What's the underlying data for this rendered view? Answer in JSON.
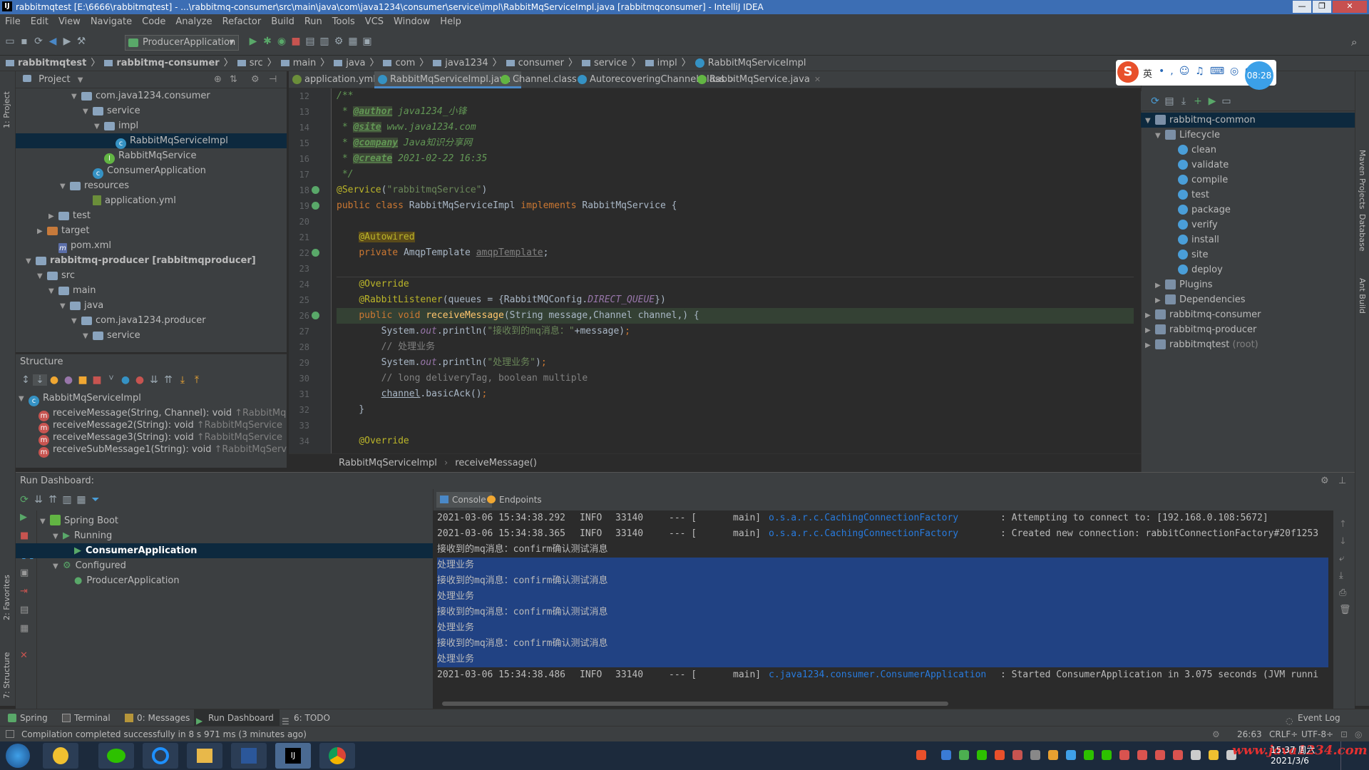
{
  "window": {
    "title": "rabbitmqtest [E:\\6666\\rabbitmqtest] - ...\\rabbitmq-consumer\\src\\main\\java\\com\\java1234\\consumer\\service\\impl\\RabbitMqServiceImpl.java [rabbitmqconsumer] - IntelliJ IDEA",
    "min": "—",
    "max": "❐",
    "close": "✕"
  },
  "menu": [
    "File",
    "Edit",
    "View",
    "Navigate",
    "Code",
    "Analyze",
    "Refactor",
    "Build",
    "Run",
    "Tools",
    "VCS",
    "Window",
    "Help"
  ],
  "toolbar": {
    "run_config": "ProducerApplication"
  },
  "navbar": [
    "rabbitmqtest",
    "rabbitmq-consumer",
    "src",
    "main",
    "java",
    "com",
    "java1234",
    "consumer",
    "service",
    "impl",
    "RabbitMqServiceImpl"
  ],
  "project": {
    "header": "Project",
    "tree": [
      {
        "label": "com.java1234.consumer",
        "indent": 4,
        "arrow": "▼",
        "icon": "folder"
      },
      {
        "label": "service",
        "indent": 5,
        "arrow": "▼",
        "icon": "folder"
      },
      {
        "label": "impl",
        "indent": 6,
        "arrow": "▼",
        "icon": "folder"
      },
      {
        "label": "RabbitMqServiceImpl",
        "indent": 7,
        "arrow": "",
        "icon": "class",
        "selected": true
      },
      {
        "label": "RabbitMqService",
        "indent": 6,
        "arrow": "",
        "icon": "interface"
      },
      {
        "label": "ConsumerApplication",
        "indent": 5,
        "arrow": "",
        "icon": "class"
      },
      {
        "label": "resources",
        "indent": 3,
        "arrow": "▼",
        "icon": "folder"
      },
      {
        "label": "application.yml",
        "indent": 5,
        "arrow": "",
        "icon": "yml"
      },
      {
        "label": "test",
        "indent": 2,
        "arrow": "▶",
        "icon": "folder"
      },
      {
        "label": "target",
        "indent": 1,
        "arrow": "▶",
        "icon": "folder-orange"
      },
      {
        "label": "pom.xml",
        "indent": 2,
        "arrow": "",
        "icon": "maven"
      },
      {
        "label": "rabbitmq-producer [rabbitmqproducer]",
        "indent": 0,
        "arrow": "▼",
        "icon": "folder"
      },
      {
        "label": "src",
        "indent": 1,
        "arrow": "▼",
        "icon": "folder"
      },
      {
        "label": "main",
        "indent": 2,
        "arrow": "▼",
        "icon": "folder"
      },
      {
        "label": "java",
        "indent": 3,
        "arrow": "▼",
        "icon": "folder"
      },
      {
        "label": "com.java1234.producer",
        "indent": 4,
        "arrow": "▼",
        "icon": "folder"
      },
      {
        "label": "service",
        "indent": 5,
        "arrow": "▼",
        "icon": "folder"
      }
    ]
  },
  "structure": {
    "header": "Structure",
    "root": "RabbitMqServiceImpl",
    "items": [
      {
        "sig": "receiveMessage(String, Channel): void",
        "type": "↑RabbitMqSe"
      },
      {
        "sig": "receiveMessage2(String): void",
        "type": "↑RabbitMqService"
      },
      {
        "sig": "receiveMessage3(String): void",
        "type": "↑RabbitMqService"
      },
      {
        "sig": "receiveSubMessage1(String): void",
        "type": "↑RabbitMqService"
      }
    ]
  },
  "tabs": [
    {
      "label": "application.yml",
      "color": "#6b8e3a"
    },
    {
      "label": "RabbitMqServiceImpl.java",
      "color": "#3592c4",
      "active": true
    },
    {
      "label": "Channel.class",
      "color": "#62b543"
    },
    {
      "label": "AutorecoveringChannel.class",
      "color": "#3592c4"
    },
    {
      "label": "RabbitMqService.java",
      "color": "#62b543"
    }
  ],
  "code": {
    "line_numbers": [
      "12",
      "13",
      "14",
      "15",
      "16",
      "17",
      "18",
      "19",
      "20",
      "21",
      "22",
      "23",
      "24",
      "25",
      "26",
      "27",
      "28",
      "29",
      "30",
      "31",
      "32",
      "33",
      "34"
    ],
    "breadcrumb": [
      "RabbitMqServiceImpl",
      "receiveMessage()"
    ]
  },
  "maven": {
    "root": "rabbitmq-common",
    "lifecycle_label": "Lifecycle",
    "lifecycle": [
      "clean",
      "validate",
      "compile",
      "test",
      "package",
      "verify",
      "install",
      "site",
      "deploy"
    ],
    "plugins": "Plugins",
    "dependencies": "Dependencies",
    "modules": [
      "rabbitmq-consumer",
      "rabbitmq-producer",
      "rabbitmqtest"
    ],
    "root_suffix": "(root)"
  },
  "ime": {
    "lang": "英",
    "clock": "08:28"
  },
  "run": {
    "header": "Run Dashboard:",
    "spring_boot": "Spring Boot",
    "running": "Running",
    "consumer": "ConsumerApplication",
    "configured": "Configured",
    "producer": "ProducerApplication",
    "console_tab": "Console",
    "endpoints_tab": "Endpoints"
  },
  "console": [
    {
      "ts": "2021-03-06 15:34:38.292",
      "level": "INFO",
      "pid": "33140",
      "sep": "--- [",
      "thread": "main]",
      "logger": "o.s.a.r.c.CachingConnectionFactory",
      "msg": ": Attempting to connect to: [192.168.0.108:5672]"
    },
    {
      "ts": "2021-03-06 15:34:38.365",
      "level": "INFO",
      "pid": "33140",
      "sep": "--- [",
      "thread": "main]",
      "logger": "o.s.a.r.c.CachingConnectionFactory",
      "msg": ": Created new connection: rabbitConnectionFactory#20f1253"
    },
    {
      "text": "接收到的mq消息：confirm确认测试消息"
    },
    {
      "text": "处理业务",
      "selected": true
    },
    {
      "text": "接收到的mq消息：confirm确认测试消息",
      "selected": true
    },
    {
      "text": "处理业务",
      "selected": true
    },
    {
      "text": "接收到的mq消息：confirm确认测试消息",
      "selected": true
    },
    {
      "text": "处理业务",
      "selected": true
    },
    {
      "text": "接收到的mq消息：confirm确认测试消息",
      "selected": true
    },
    {
      "text": "处理业务",
      "selected": true
    },
    {
      "ts": "2021-03-06 15:34:38.486",
      "level": "INFO",
      "pid": "33140",
      "sep": "--- [",
      "thread": "main]",
      "logger": "c.java1234.consumer.ConsumerApplication",
      "msg": ": Started ConsumerApplication in 3.075 seconds (JVM runni"
    }
  ],
  "bottom_tabs": [
    "Spring",
    "Terminal",
    "0: Messages",
    "Run Dashboard",
    "6: TODO"
  ],
  "event_log": "Event Log",
  "status": {
    "message": "Compilation completed successfully in 8 s 971 ms (3 minutes ago)",
    "position": "26:63",
    "line_sep": "CRLF÷",
    "encoding": "UTF-8÷"
  },
  "side_tabs": {
    "project": "1: Project",
    "favorites": "2: Favorites",
    "structure": "7: Structure",
    "maven": "Maven Projects",
    "database": "Database",
    "ant": "Ant Build"
  },
  "taskbar": {
    "time": "15:37 周六",
    "date": "2021/3/6",
    "watermark": "www.java1234.com"
  }
}
